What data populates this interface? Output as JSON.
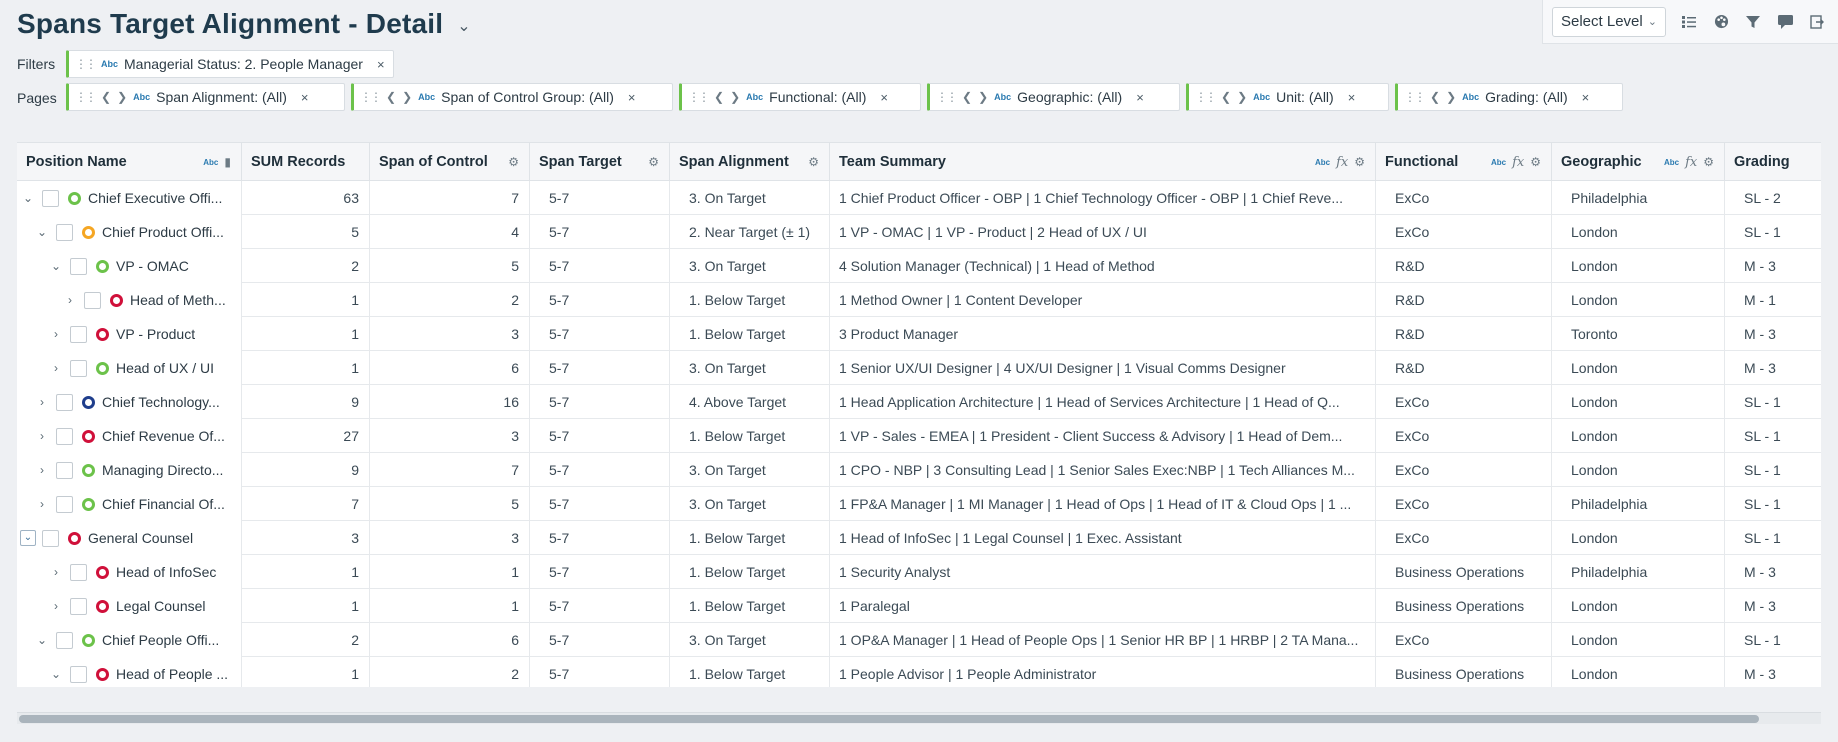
{
  "title": "Spans Target Alignment - Detail",
  "toolbar": {
    "select_level": "Select Level",
    "icons": [
      "list-icon",
      "palette-icon",
      "filter-icon",
      "comment-icon",
      "exit-icon"
    ]
  },
  "filters": {
    "label": "Filters",
    "items": [
      {
        "text": "Managerial Status: 2. People Manager"
      }
    ]
  },
  "pages": {
    "label": "Pages",
    "items": [
      {
        "text": "Span Alignment: (All)"
      },
      {
        "text": "Span of Control Group: (All)"
      },
      {
        "text": "Functional: (All)"
      },
      {
        "text": "Geographic: (All)"
      },
      {
        "text": "Unit: (All)"
      },
      {
        "text": "Grading: (All)"
      }
    ]
  },
  "abc": "Abc",
  "fx": "fx",
  "close": "×",
  "columns": [
    "Position Name",
    "SUM Records",
    "Span of Control",
    "Span Target",
    "Span Alignment",
    "Team Summary",
    "Functional",
    "Geographic",
    "Grading"
  ],
  "colors": {
    "green": "#6cc24a",
    "orange": "#f5a623",
    "red": "#d0103a",
    "navy": "#1f3e8c",
    "accent": "#6cc24a"
  },
  "rows": [
    {
      "level": 0,
      "expand": "down",
      "status": "green",
      "name": "Chief Executive Offi...",
      "sum": "63",
      "soc": "7",
      "target": "5-7",
      "align": "3. On Target",
      "team": "1 Chief Product Officer - OBP | 1 Chief Technology Officer - OBP | 1 Chief Reve...",
      "func": "ExCo",
      "geo": "Philadelphia",
      "grade": "SL - 2"
    },
    {
      "level": 1,
      "expand": "down",
      "status": "orange",
      "name": "Chief Product Offi...",
      "sum": "5",
      "soc": "4",
      "target": "5-7",
      "align": "2. Near Target (± 1)",
      "team": "1 VP - OMAC | 1 VP - Product | 2 Head of UX / UI",
      "func": "ExCo",
      "geo": "London",
      "grade": "SL - 1"
    },
    {
      "level": 2,
      "expand": "down",
      "status": "green",
      "name": "VP - OMAC",
      "sum": "2",
      "soc": "5",
      "target": "5-7",
      "align": "3. On Target",
      "team": "4 Solution Manager (Technical) | 1 Head of Method",
      "func": "R&D",
      "geo": "London",
      "grade": "M - 3"
    },
    {
      "level": 3,
      "expand": "right",
      "status": "red",
      "name": "Head of Meth...",
      "sum": "1",
      "soc": "2",
      "target": "5-7",
      "align": "1. Below Target",
      "team": "1 Method Owner | 1 Content Developer",
      "func": "R&D",
      "geo": "London",
      "grade": "M - 1"
    },
    {
      "level": 2,
      "expand": "right",
      "status": "red",
      "name": "VP - Product",
      "sum": "1",
      "soc": "3",
      "target": "5-7",
      "align": "1. Below Target",
      "team": "3 Product Manager",
      "func": "R&D",
      "geo": "Toronto",
      "grade": "M - 3"
    },
    {
      "level": 2,
      "expand": "right",
      "status": "green",
      "name": "Head of UX / UI",
      "sum": "1",
      "soc": "6",
      "target": "5-7",
      "align": "3. On Target",
      "team": "1 Senior UX/UI Designer | 4 UX/UI Designer | 1 Visual Comms Designer",
      "func": "R&D",
      "geo": "London",
      "grade": "M - 3"
    },
    {
      "level": 1,
      "expand": "right",
      "status": "navy",
      "name": "Chief Technology...",
      "sum": "9",
      "soc": "16",
      "target": "5-7",
      "align": "4. Above Target",
      "team": "1 Head Application Architecture | 1 Head of Services Architecture | 1 Head of Q...",
      "func": "ExCo",
      "geo": "London",
      "grade": "SL - 1"
    },
    {
      "level": 1,
      "expand": "right",
      "status": "red",
      "name": "Chief Revenue Of...",
      "sum": "27",
      "soc": "3",
      "target": "5-7",
      "align": "1. Below Target",
      "team": "1 VP - Sales - EMEA | 1 President -  Client Success & Advisory | 1 Head of Dem...",
      "func": "ExCo",
      "geo": "London",
      "grade": "SL - 1"
    },
    {
      "level": 1,
      "expand": "right",
      "status": "green",
      "name": "Managing Directo...",
      "sum": "9",
      "soc": "7",
      "target": "5-7",
      "align": "3. On Target",
      "team": "1 CPO - NBP | 3 Consulting Lead | 1 Senior Sales Exec:NBP | 1 Tech Alliances M...",
      "func": "ExCo",
      "geo": "London",
      "grade": "SL - 1"
    },
    {
      "level": 1,
      "expand": "right",
      "status": "green",
      "name": "Chief Financial Of...",
      "sum": "7",
      "soc": "5",
      "target": "5-7",
      "align": "3. On Target",
      "team": "1 FP&A Manager | 1 MI Manager | 1 Head of Ops | 1 Head of IT & Cloud Ops | 1 ...",
      "func": "ExCo",
      "geo": "Philadelphia",
      "grade": "SL - 1"
    },
    {
      "level": 0,
      "expand": "boxed",
      "status": "red",
      "name": "General Counsel",
      "sum": "3",
      "soc": "3",
      "target": "5-7",
      "align": "1. Below Target",
      "team": "1 Head of InfoSec | 1 Legal Counsel | 1 Exec. Assistant",
      "func": "ExCo",
      "geo": "London",
      "grade": "SL - 1"
    },
    {
      "level": 2,
      "expand": "right",
      "status": "red",
      "name": "Head of InfoSec",
      "sum": "1",
      "soc": "1",
      "target": "5-7",
      "align": "1. Below Target",
      "team": "1 Security Analyst",
      "func": "Business Operations",
      "geo": "Philadelphia",
      "grade": "M - 3"
    },
    {
      "level": 2,
      "expand": "right",
      "status": "red",
      "name": "Legal Counsel",
      "sum": "1",
      "soc": "1",
      "target": "5-7",
      "align": "1. Below Target",
      "team": "1 Paralegal",
      "func": "Business Operations",
      "geo": "London",
      "grade": "M - 3"
    },
    {
      "level": 1,
      "expand": "down",
      "status": "green",
      "name": "Chief People Offi...",
      "sum": "2",
      "soc": "6",
      "target": "5-7",
      "align": "3. On Target",
      "team": "1 OP&A Manager | 1 Head of People Ops | 1 Senior HR BP | 1 HRBP | 2 TA Mana...",
      "func": "ExCo",
      "geo": "London",
      "grade": "SL - 1"
    },
    {
      "level": 2,
      "expand": "down",
      "status": "red",
      "name": "Head of People ...",
      "sum": "1",
      "soc": "2",
      "target": "5-7",
      "align": "1. Below Target",
      "team": "1 People Advisor | 1 People Administrator",
      "func": "Business Operations",
      "geo": "London",
      "grade": "M - 3"
    }
  ]
}
